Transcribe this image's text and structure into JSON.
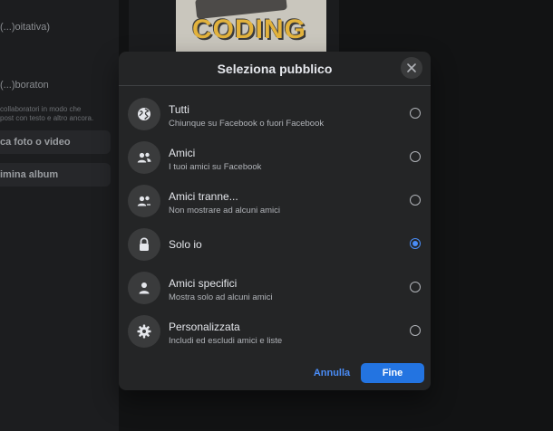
{
  "background": {
    "visibility_label": "(...)oitativa)",
    "collaborators_label": "(...)boraton",
    "collaborators_hint": "collaboratori in modo che\npost con testo e altro ancora.",
    "add_button_label": "ca foto o video",
    "delete_button_label": "imina album",
    "image_text": "CODING"
  },
  "modal": {
    "title": "Seleziona pubblico",
    "close_icon": "close-icon",
    "options": [
      {
        "label": "Tutti",
        "sub": "Chiunque su Facebook o fuori Facebook",
        "icon": "globe-icon",
        "selected": false
      },
      {
        "label": "Amici",
        "sub": "I tuoi amici su Facebook",
        "icon": "friends-icon",
        "selected": false
      },
      {
        "label": "Amici tranne...",
        "sub": "Non mostrare ad alcuni amici",
        "icon": "friends-except-icon",
        "selected": false
      },
      {
        "label": "Solo io",
        "sub": "",
        "icon": "lock-icon",
        "selected": true
      },
      {
        "label": "Amici specifici",
        "sub": "Mostra solo ad alcuni amici",
        "icon": "person-icon",
        "selected": false
      },
      {
        "label": "Personalizzata",
        "sub": "Includi ed escludi amici e liste",
        "icon": "gear-icon",
        "selected": false
      }
    ],
    "cancel_label": "Annulla",
    "done_label": "Fine"
  },
  "colors": {
    "accent": "#2374e1",
    "link": "#4a8df8",
    "modal_bg": "#242526",
    "icon_bg": "#3a3b3c"
  }
}
